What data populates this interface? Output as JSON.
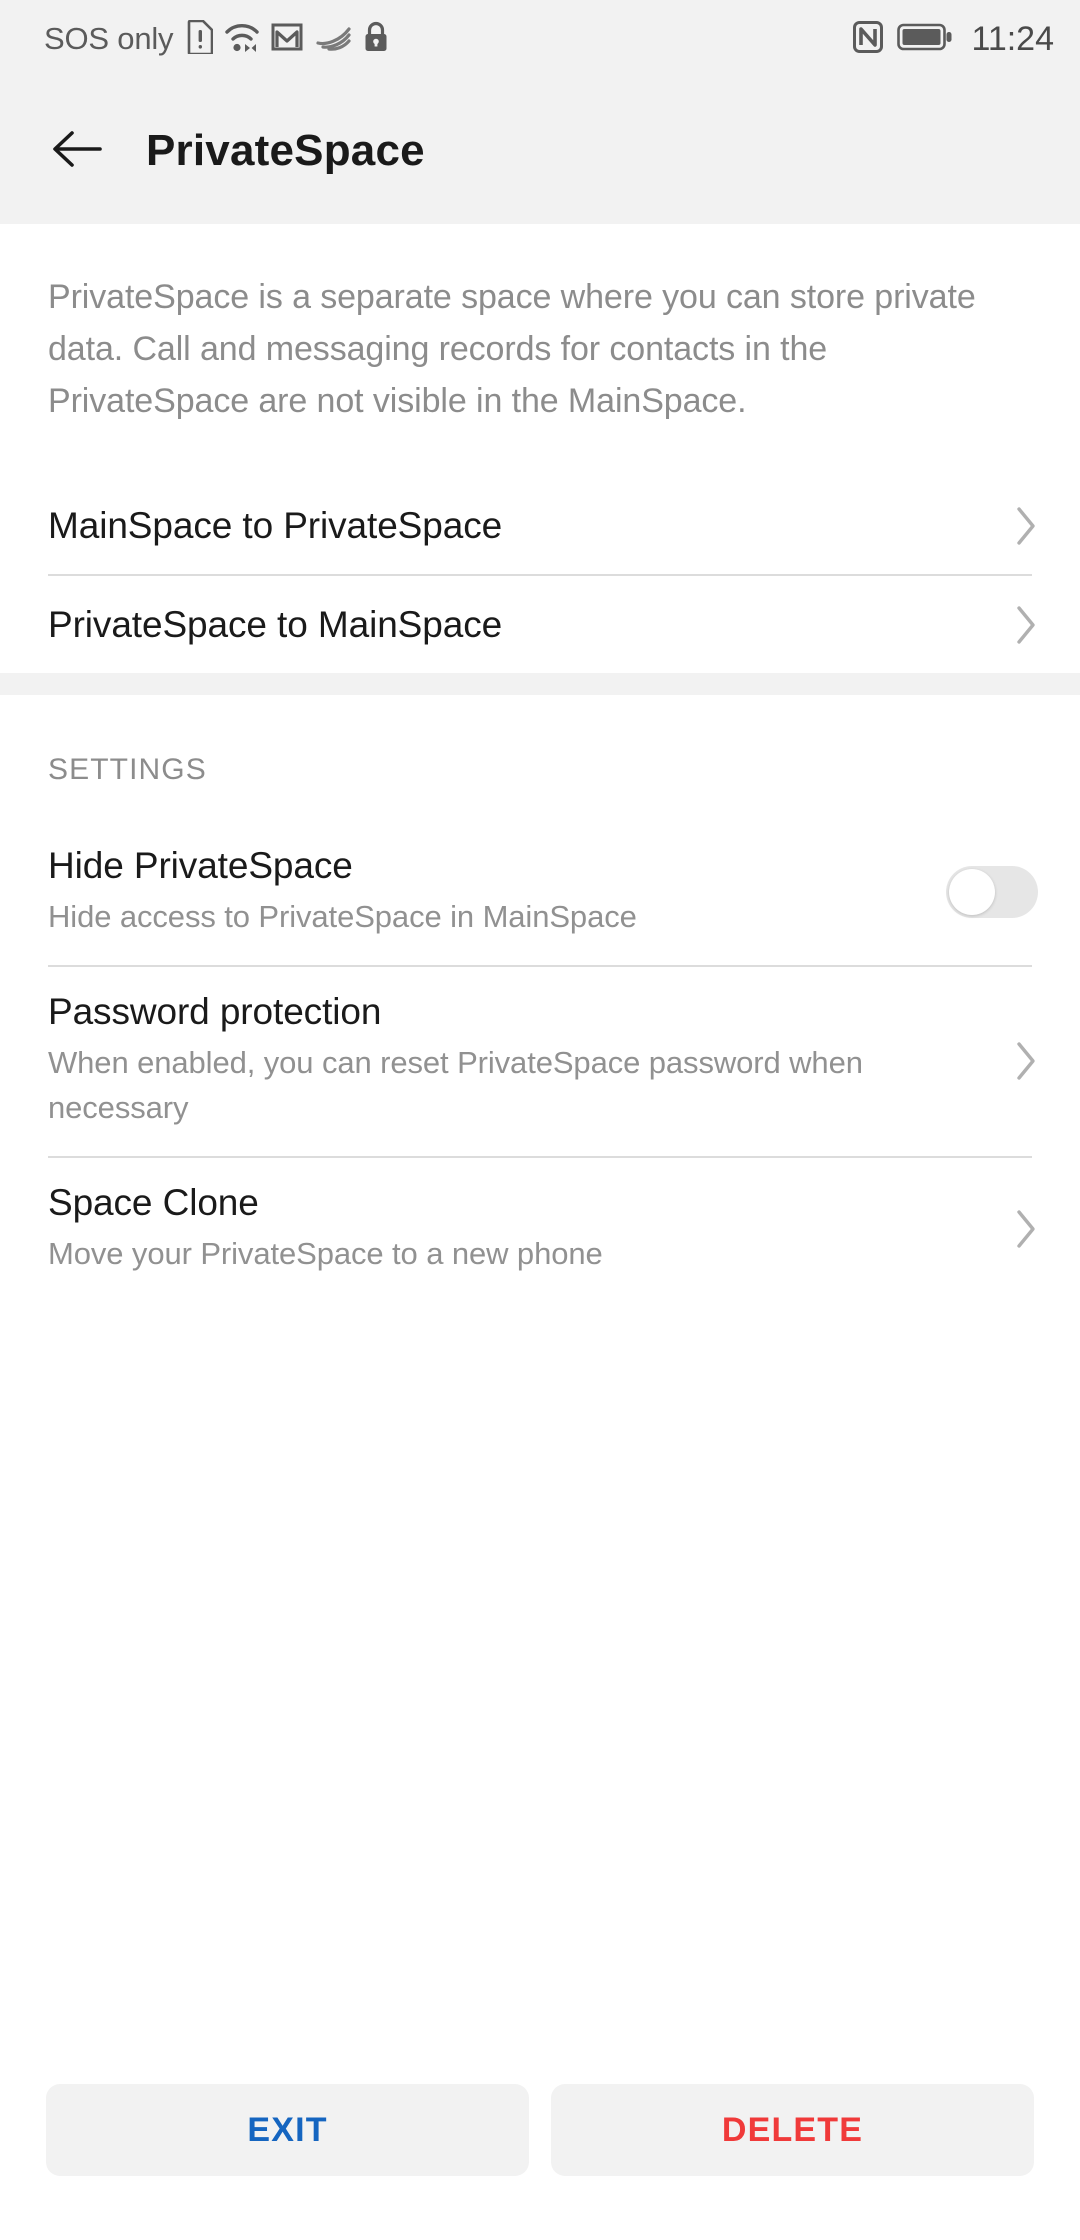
{
  "status_bar": {
    "carrier_text": "SOS only",
    "time": "11:24",
    "left_icons": [
      "sim-warning-icon",
      "wifi-icon",
      "gmail-icon",
      "swiftkey-icon",
      "lock-icon"
    ],
    "right_icons": [
      "nfc-icon",
      "battery-icon"
    ]
  },
  "app_bar": {
    "back_icon": "back-arrow-icon",
    "title": "PrivateSpace"
  },
  "description": "PrivateSpace is a separate space where you can store private data. Call and messaging records for contacts in the PrivateSpace are not visible in the MainSpace.",
  "nav_rows": [
    {
      "title": "MainSpace to PrivateSpace",
      "chevron": "chevron-right-icon"
    },
    {
      "title": "PrivateSpace to MainSpace",
      "chevron": "chevron-right-icon"
    }
  ],
  "settings": {
    "header": "SETTINGS",
    "hide_private_space": {
      "title": "Hide PrivateSpace",
      "subtitle": "Hide access to PrivateSpace in MainSpace",
      "toggle_state": "off"
    },
    "password_protection": {
      "title": "Password protection",
      "subtitle": "When enabled, you can reset PrivateSpace password when necessary",
      "chevron": "chevron-right-icon"
    },
    "space_clone": {
      "title": "Space Clone",
      "subtitle": "Move your PrivateSpace to a new phone",
      "chevron": "chevron-right-icon"
    }
  },
  "buttons": {
    "exit": "EXIT",
    "delete": "DELETE"
  },
  "colors": {
    "exit_blue": "#1565c0",
    "delete_red": "#f03a3a",
    "bar_gray": "#f2f2f2",
    "divider": "#dcdcdc",
    "secondary_text": "#919191"
  }
}
